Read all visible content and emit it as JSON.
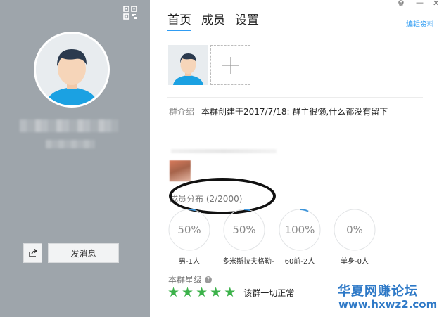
{
  "tabs": [
    {
      "label": "首页",
      "active": true
    },
    {
      "label": "成员",
      "active": false
    },
    {
      "label": "设置",
      "active": false
    }
  ],
  "edit_link": "编辑资料",
  "window_controls": {
    "settings": "⚙",
    "minimize": "—",
    "close": "✕"
  },
  "left_panel": {
    "send_message_label": "发消息"
  },
  "intro": {
    "label": "群介绍",
    "text": "本群创建于2017/7/18:  群主很懒,什么都没有留下"
  },
  "distribution": {
    "title": "成员分布 (2/2000)",
    "stats": [
      {
        "percent_label": "50%",
        "percent": 50,
        "caption": "男-1人"
      },
      {
        "percent_label": "50%",
        "percent": 50,
        "caption": "多米斯拉夫格勒-"
      },
      {
        "percent_label": "100%",
        "percent": 100,
        "caption": "60前-2人"
      },
      {
        "percent_label": "0%",
        "percent": 0,
        "caption": "单身-0人"
      }
    ]
  },
  "rating": {
    "title": "本群星级",
    "stars": 5,
    "status": "该群一切正常"
  },
  "watermark": {
    "line1": "华夏网赚论坛",
    "line2": "www.hxwz2.com"
  },
  "colors": {
    "accent": "#2f9cf3",
    "star": "#3cb24a",
    "sidebar": "#9ea5ab",
    "watermark": "#2e79c7"
  }
}
